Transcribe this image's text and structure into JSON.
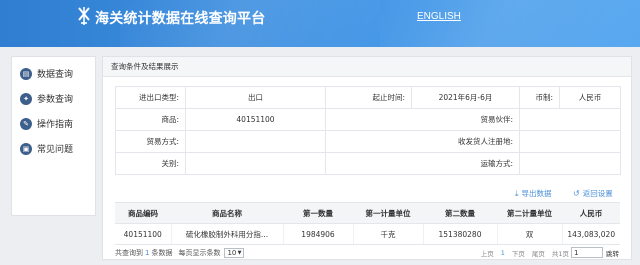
{
  "header": {
    "title": "海关统计数据在线查询平台",
    "lang_link": "ENGLISH"
  },
  "sidebar": {
    "items": [
      {
        "label": "数据查询",
        "icon": "data-query-icon"
      },
      {
        "label": "参数查询",
        "icon": "parameter-query-icon"
      },
      {
        "label": "操作指南",
        "icon": "guide-icon"
      },
      {
        "label": "常见问题",
        "icon": "faq-icon"
      }
    ]
  },
  "panel": {
    "title": "查询条件及结果展示"
  },
  "criteria": {
    "trade_type_label": "进出口类型:",
    "trade_type_value": "出口",
    "period_label": "起止时间:",
    "period_value": "2021年6月-6月",
    "currency_label": "币制:",
    "currency_value": "人民币",
    "commodity_label": "商品:",
    "commodity_value": "40151100",
    "partner_label": "贸易伙伴:",
    "partner_value": "",
    "trade_mode_label": "贸易方式:",
    "trade_mode_value": "",
    "consignee_label": "收发货人注册地:",
    "consignee_value": "",
    "customs_label": "关别:",
    "customs_value": "",
    "transport_label": "运输方式:",
    "transport_value": ""
  },
  "actions": {
    "export_label": "导出数据",
    "back_label": "返回设置"
  },
  "results": {
    "columns": [
      "商品编码",
      "商品名称",
      "第一数量",
      "第一计量单位",
      "第二数量",
      "第二计量单位",
      "人民币"
    ],
    "rows": [
      [
        "40151100",
        "硫化橡胶制外科用分指...",
        "1984906",
        "千克",
        "151380280",
        "双",
        "143,083,020"
      ]
    ]
  },
  "footer": {
    "total_prefix": "共查询到",
    "total_count": "1",
    "total_suffix": "条数据",
    "page_size_label": "每页显示条数",
    "page_size_value": "10",
    "pager": {
      "prev": "上页",
      "current": "1",
      "next": "下页",
      "last": "尾页",
      "total_pages": "共1页",
      "goto_value": "1",
      "go": "跳转"
    }
  },
  "colors": {
    "header_start": "#2f7ed1",
    "header_end": "#58a8f0",
    "accent": "#4a90d9",
    "icon_bg": "#3d5f8c"
  }
}
